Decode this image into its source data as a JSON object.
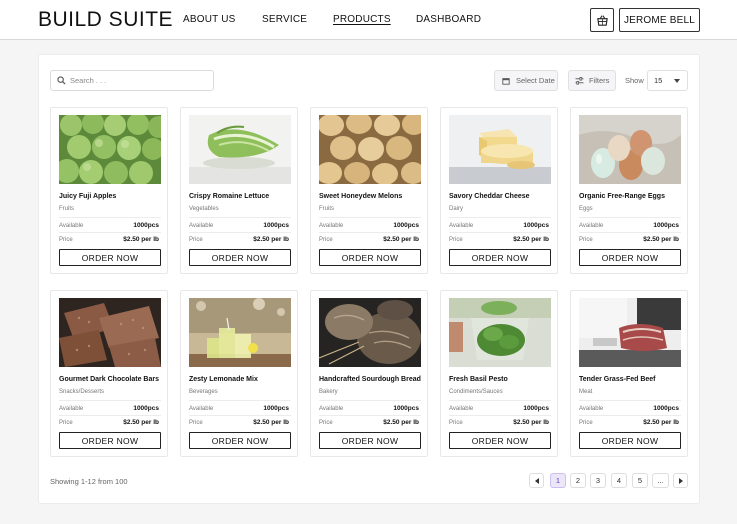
{
  "header": {
    "logo": "BUILD SUITE",
    "nav": [
      {
        "label": "ABOUT US",
        "active": false
      },
      {
        "label": "SERVICE",
        "active": false
      },
      {
        "label": "PRODUCTS",
        "active": true
      },
      {
        "label": "DASHBOARD",
        "active": false
      }
    ],
    "cart_icon": "basket-icon",
    "user_name": "JEROME BELL"
  },
  "toolbar": {
    "search_placeholder": "Search . . .",
    "date_label": "Select Date",
    "filter_label": "Filters",
    "show_label": "Show",
    "show_value": "15"
  },
  "labels": {
    "available": "Available",
    "price": "Price",
    "order": "ORDER NOW"
  },
  "products": [
    {
      "name": "Juicy Fuji Apples",
      "category": "Fruits",
      "available": "1000pcs",
      "price": "$2.50 per lb",
      "image": "apples"
    },
    {
      "name": "Crispy Romaine Lettuce",
      "category": "Vegetables",
      "available": "1000pcs",
      "price": "$2.50 per lb",
      "image": "lettuce"
    },
    {
      "name": "Sweet Honeydew Melons",
      "category": "Fruits",
      "available": "1000pcs",
      "price": "$2.50 per lb",
      "image": "melons"
    },
    {
      "name": "Savory Cheddar Cheese",
      "category": "Dairy",
      "available": "1000pcs",
      "price": "$2.50 per lb",
      "image": "cheese"
    },
    {
      "name": "Organic Free-Range Eggs",
      "category": "Eggs",
      "available": "1000pcs",
      "price": "$2.50 per lb",
      "image": "eggs"
    },
    {
      "name": "Gourmet Dark Chocolate Bars",
      "category": "Snacks/Desserts",
      "available": "1000pcs",
      "price": "$2.50 per lb",
      "image": "chocolate"
    },
    {
      "name": "Zesty Lemonade Mix",
      "category": "Beverages",
      "available": "1000pcs",
      "price": "$2.50 per lb",
      "image": "lemonade"
    },
    {
      "name": "Handcrafted Sourdough Bread",
      "category": "Bakery",
      "available": "1000pcs",
      "price": "$2.50 per lb",
      "image": "bread"
    },
    {
      "name": "Fresh Basil Pesto",
      "category": "Condiments/Sauces",
      "available": "1000pcs",
      "price": "$2.50 per lb",
      "image": "pesto"
    },
    {
      "name": "Tender Grass-Fed Beef",
      "category": "Meat",
      "available": "1000pcs",
      "price": "$2.50 per lb",
      "image": "beef"
    }
  ],
  "pagination": {
    "showing": "Showing 1-12 from 100",
    "pages": [
      "1",
      "2",
      "3",
      "4",
      "5",
      "..."
    ],
    "active": "1"
  },
  "colors": {
    "accent": "#5b45b8",
    "active_page_bg": "#ece6f8",
    "page_bg": "#f5f5f6"
  }
}
